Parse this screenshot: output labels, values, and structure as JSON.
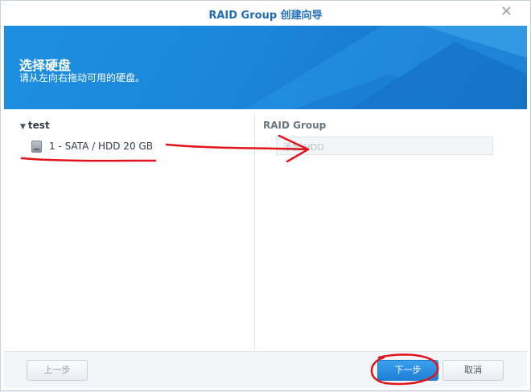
{
  "window": {
    "title": "RAID Group 创建向导",
    "close_symbol": "✕"
  },
  "banner": {
    "title": "选择硬盘",
    "subtitle": "请从左向右拖动可用的硬盘。"
  },
  "left_pane": {
    "group_name": "test",
    "disks": [
      {
        "label": "1 - SATA / HDD 20 GB",
        "icon": "hdd-icon"
      }
    ]
  },
  "right_pane": {
    "header": "RAID Group",
    "drop_placeholder": "添加 HDD"
  },
  "footer": {
    "prev_label": "上一步",
    "next_label": "下一步",
    "cancel_label": "取消"
  },
  "colors": {
    "accent": "#1e8fe0",
    "annotation": "#e0141b"
  }
}
